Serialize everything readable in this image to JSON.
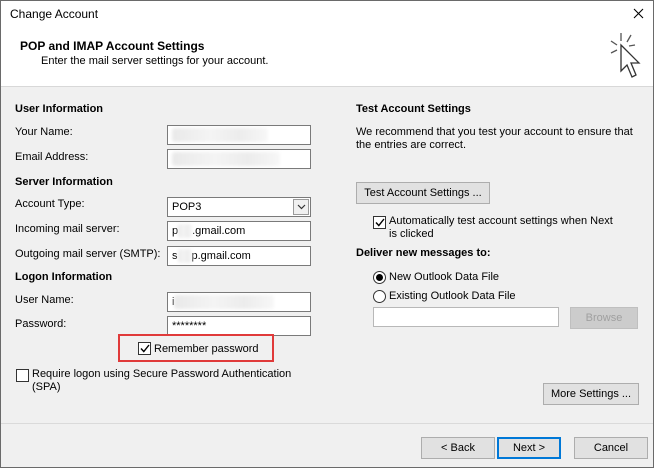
{
  "window": {
    "title": "Change Account",
    "close_glyph": "✕"
  },
  "header": {
    "title": "POP and IMAP Account Settings",
    "subtitle": "Enter the mail server settings for your account.",
    "icon": "wizard-cursor-icon"
  },
  "user_info": {
    "section": "User Information",
    "your_name_label": "Your Name:",
    "email_label": "Email Address:"
  },
  "server_info": {
    "section": "Server Information",
    "account_type_label": "Account Type:",
    "account_type_value": "POP3",
    "incoming_label": "Incoming mail server:",
    "incoming_visible": "p",
    "incoming_suffix": ".gmail.com",
    "outgoing_label": "Outgoing mail server (SMTP):",
    "outgoing_visible": "s",
    "outgoing_suffix": "p.gmail.com"
  },
  "logon_info": {
    "section": "Logon Information",
    "username_label": "User Name:",
    "username_visible": "i",
    "password_label": "Password:",
    "password_value": "********",
    "remember_label": "Remember password",
    "remember_checked": true,
    "spa_label_line1": "Require logon using Secure Password Authentication",
    "spa_label_line2": "(SPA)",
    "spa_checked": false
  },
  "test_settings": {
    "section": "Test Account Settings",
    "description_line1": "We recommend that you test your account to ensure that",
    "description_line2": "the entries are correct.",
    "test_button": "Test Account Settings ...",
    "auto_test_line1": "Automatically test account settings when Next",
    "auto_test_line2": "is clicked",
    "auto_test_checked": true
  },
  "deliver": {
    "section": "Deliver new messages to:",
    "new_file": "New Outlook Data File",
    "existing_file": "Existing Outlook Data File",
    "selected": "new",
    "browse_button": "Browse"
  },
  "buttons": {
    "more_settings": "More Settings ...",
    "back": "< Back",
    "next": "Next >",
    "cancel": "Cancel"
  },
  "colors": {
    "highlight": "#e03a3a",
    "focus": "#0078d7"
  }
}
